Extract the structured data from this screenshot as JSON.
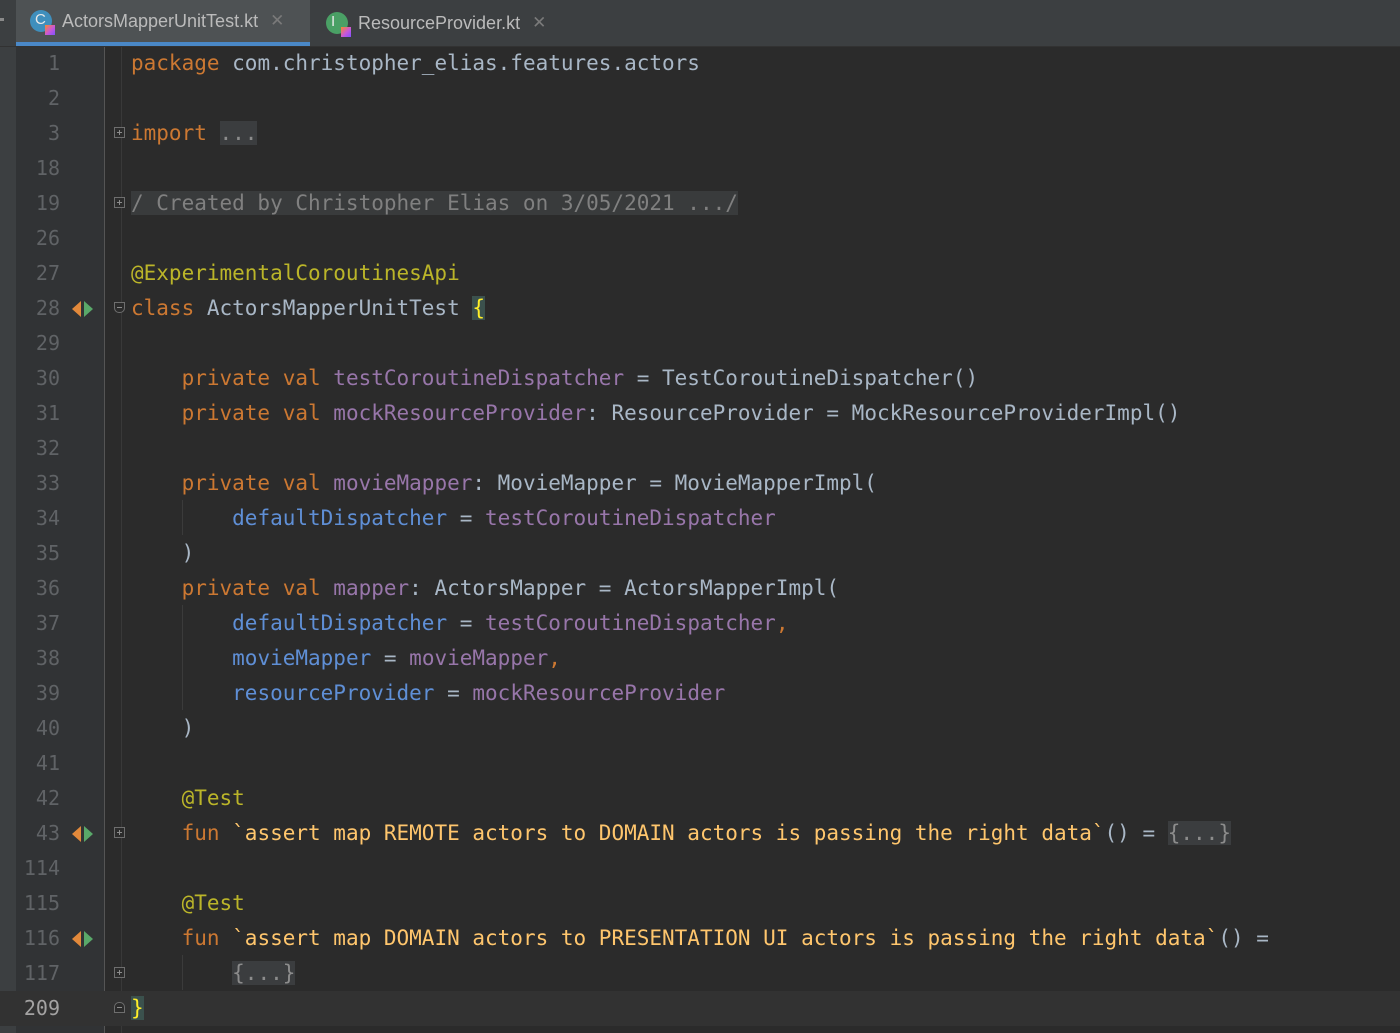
{
  "editor": {
    "tabs": [
      {
        "label": "ActorsMapperUnitTest.kt",
        "icon": "kotlin-test-file-icon",
        "active": true
      },
      {
        "label": "ResourceProvider.kt",
        "icon": "kotlin-interface-file-icon",
        "active": false
      }
    ],
    "colors": {
      "background": "#2b2b2b",
      "keyword": "#cc7832",
      "annotation": "#bbb529",
      "property": "#9876aa",
      "parameter": "#5f8fd6",
      "function": "#ffc66d",
      "comment": "#808080"
    },
    "lines": {
      "l1": {
        "n": "1",
        "a": "package",
        "b": " com.christopher_elias.features.actors"
      },
      "l2": {
        "n": "2"
      },
      "l3": {
        "n": "3",
        "a": "import",
        "b": " ",
        "c": "..."
      },
      "l18": {
        "n": "18"
      },
      "l19": {
        "n": "19",
        "a": "/ Created by Christopher Elias on 3/05/2021 .../"
      },
      "l26": {
        "n": "26"
      },
      "l27": {
        "n": "27",
        "a": "@ExperimentalCoroutinesApi"
      },
      "l28": {
        "n": "28",
        "a": "class",
        "b": " ActorsMapperUnitTest ",
        "c": "{"
      },
      "l29": {
        "n": "29"
      },
      "l30": {
        "n": "30",
        "a": "    private val ",
        "b": "testCoroutineDispatcher",
        "c": " = TestCoroutineDispatcher()"
      },
      "l31": {
        "n": "31",
        "a": "    private val ",
        "b": "mockResourceProvider",
        "c": ": ResourceProvider = MockResourceProviderImpl()"
      },
      "l32": {
        "n": "32"
      },
      "l33": {
        "n": "33",
        "a": "    private val ",
        "b": "movieMapper",
        "c": ": MovieMapper = MovieMapperImpl("
      },
      "l34": {
        "n": "34",
        "a": "        ",
        "b": "defaultDispatcher",
        "c": " = ",
        "d": "testCoroutineDispatcher"
      },
      "l35": {
        "n": "35",
        "a": "    )"
      },
      "l36": {
        "n": "36",
        "a": "    private val ",
        "b": "mapper",
        "c": ": ActorsMapper = ActorsMapperImpl("
      },
      "l37": {
        "n": "37",
        "a": "        ",
        "b": "defaultDispatcher",
        "c": " = ",
        "d": "testCoroutineDispatcher",
        "e": ","
      },
      "l38": {
        "n": "38",
        "a": "        ",
        "b": "movieMapper",
        "c": " = ",
        "d": "movieMapper",
        "e": ","
      },
      "l39": {
        "n": "39",
        "a": "        ",
        "b": "resourceProvider",
        "c": " = ",
        "d": "mockResourceProvider"
      },
      "l40": {
        "n": "40",
        "a": "    )"
      },
      "l41": {
        "n": "41"
      },
      "l42": {
        "n": "42",
        "a": "    @Test"
      },
      "l43": {
        "n": "43",
        "a": "    fun ",
        "b": "`assert map REMOTE actors to DOMAIN actors is passing the right data`",
        "c": "() = ",
        "d": "{...}"
      },
      "l114": {
        "n": "114"
      },
      "l115": {
        "n": "115",
        "a": "    @Test"
      },
      "l116": {
        "n": "116",
        "a": "    fun ",
        "b": "`assert map DOMAIN actors to PRESENTATION UI actors is passing the right data`",
        "c": "() ="
      },
      "l117": {
        "n": "117",
        "a": "        ",
        "b": "{...}"
      },
      "l209": {
        "n": "209",
        "a": "}"
      }
    }
  }
}
